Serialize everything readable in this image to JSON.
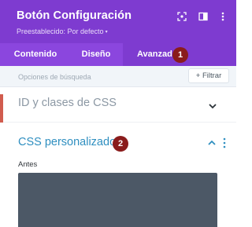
{
  "header": {
    "title": "Botón Configuración",
    "preset": "Preestablecido: Por defecto",
    "preset_caret": "▾"
  },
  "tabs": [
    {
      "label": "Contenido",
      "active": false
    },
    {
      "label": "Diseño",
      "active": false
    },
    {
      "label": "Avanzado",
      "active": true
    }
  ],
  "markers": {
    "first": "1",
    "second": "2"
  },
  "search": {
    "placeholder": "Opciones de búsqueda",
    "filter_label": "+ Filtrar"
  },
  "sections": {
    "id_classes": {
      "title": "ID y clases de CSS",
      "expanded": false
    },
    "custom_css": {
      "title": "CSS personalizado",
      "expanded": true,
      "field_label": "Antes"
    }
  },
  "colors": {
    "header_bg": "#7e3bd0",
    "tab_bar_bg": "#8b46de",
    "marker_bg": "#8a1c1c",
    "section_active_text": "#2f8fc0",
    "code_area_bg": "#4c5866"
  },
  "icons": [
    "target-icon",
    "sidebar-toggle-icon",
    "more-vertical-icon",
    "chevron-down-icon",
    "chevron-up-icon"
  ]
}
